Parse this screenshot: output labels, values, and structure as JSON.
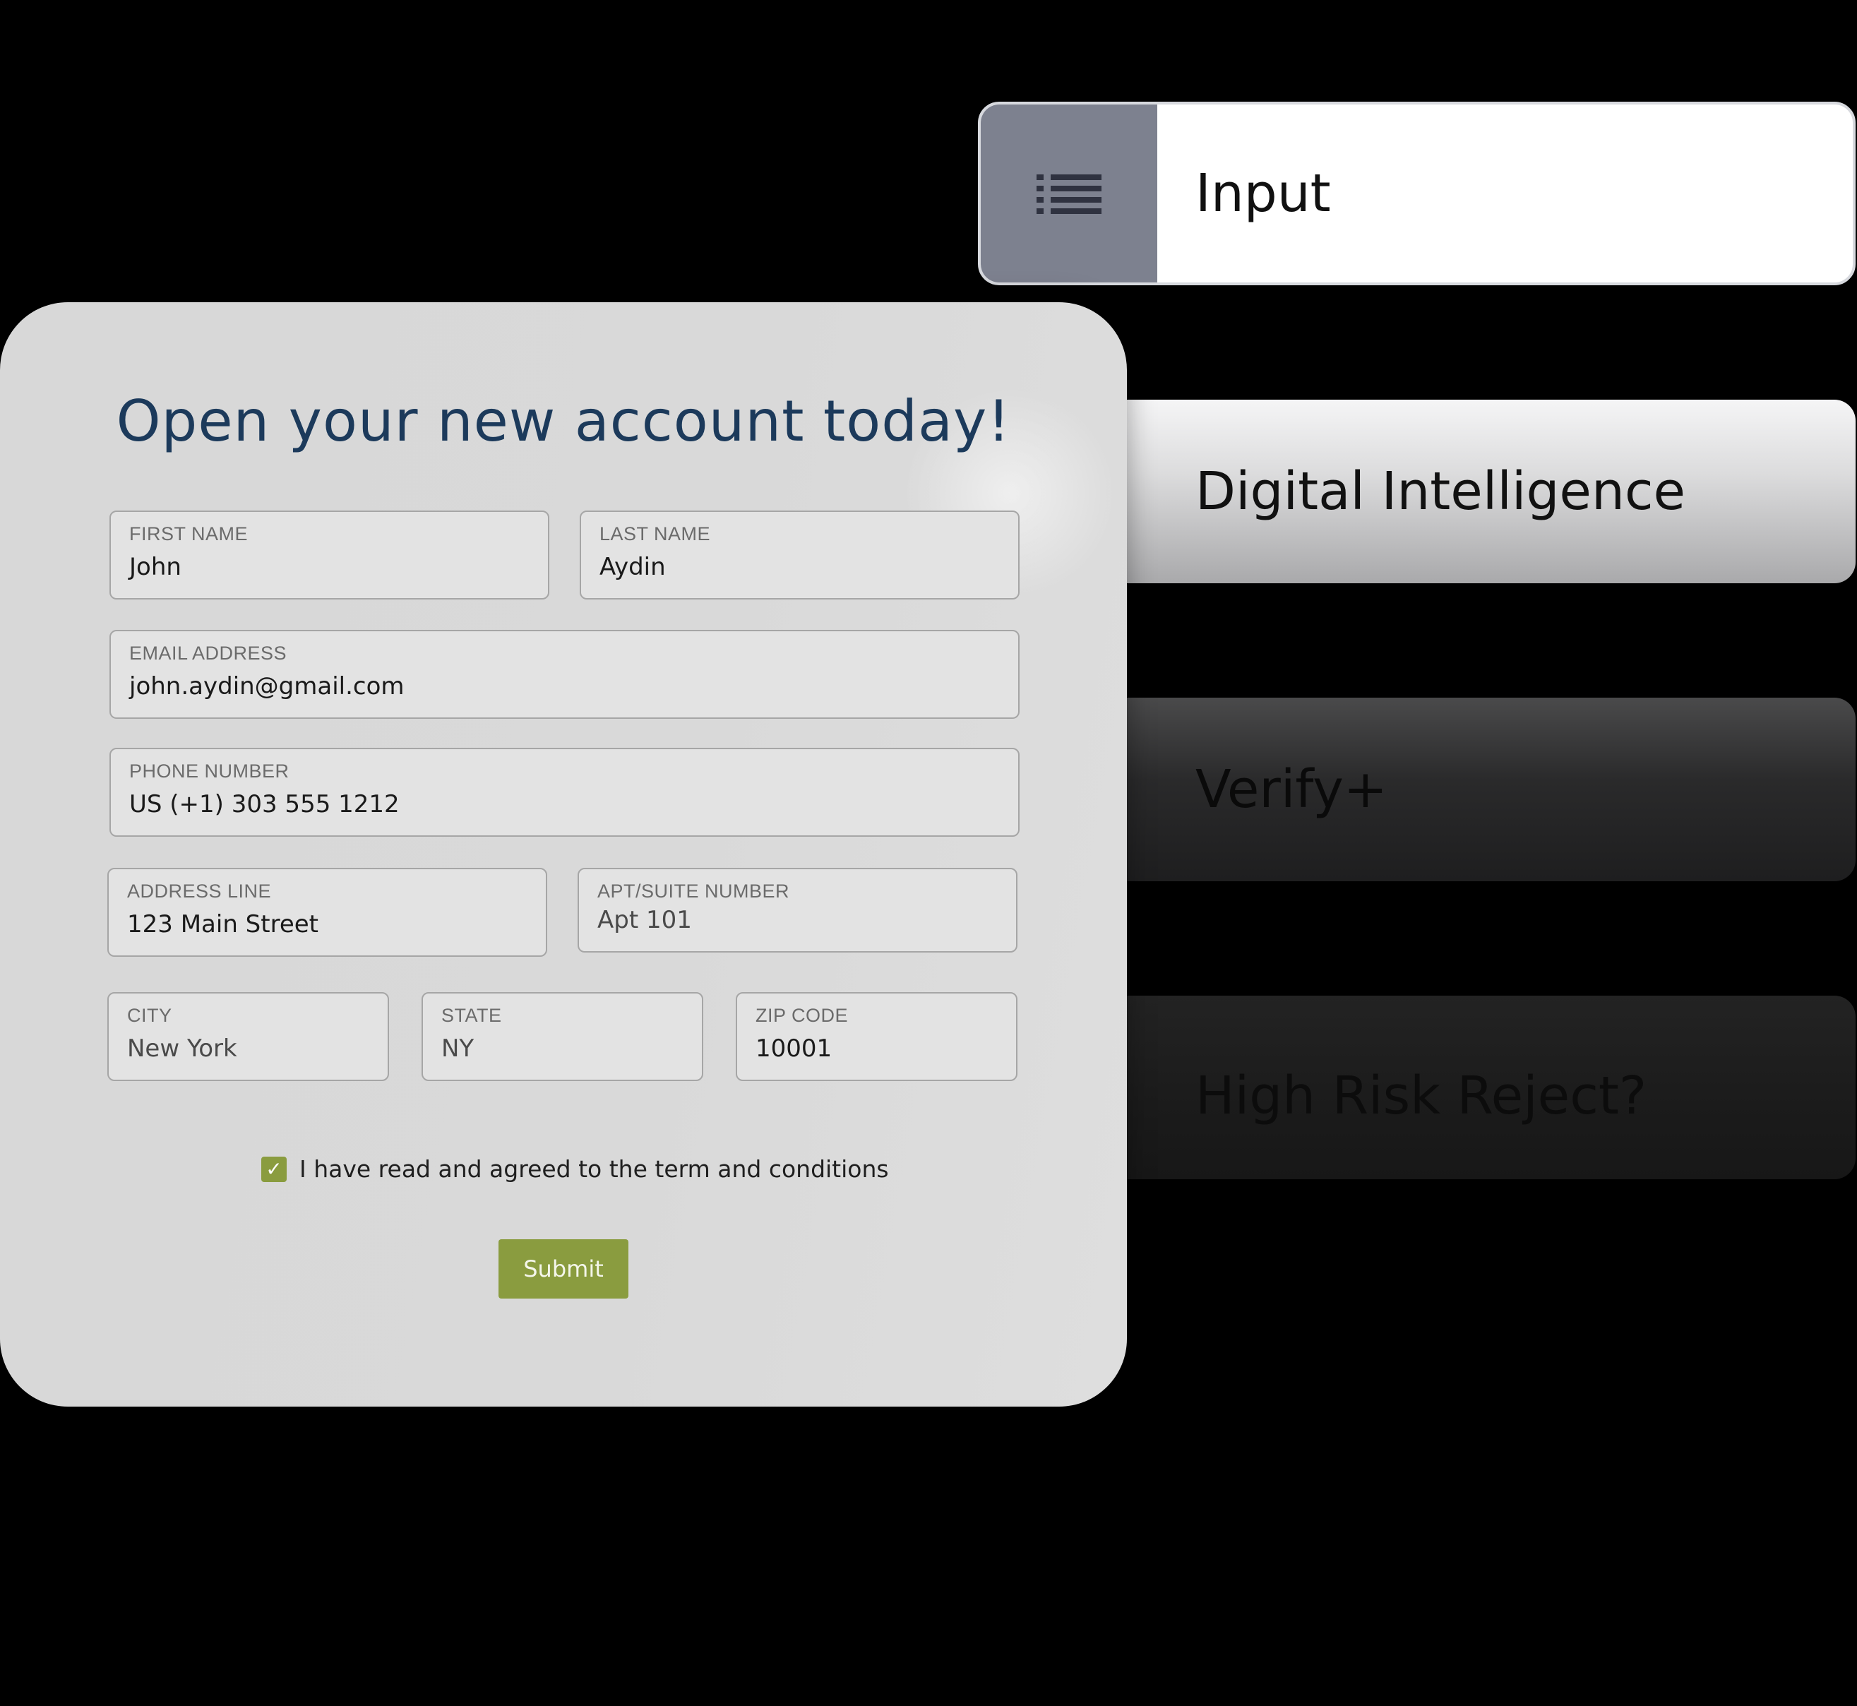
{
  "steps": {
    "input": {
      "label": "Input",
      "icon": "list-icon"
    },
    "digital_intelligence": {
      "label": "Digital Intelligence"
    },
    "verify_plus": {
      "label": "Verify+"
    },
    "high_risk_reject": {
      "label": "High Risk Reject?"
    }
  },
  "form": {
    "title": "Open your new account today!",
    "fields": {
      "first_name": {
        "label": "FIRST NAME",
        "value": "John"
      },
      "last_name": {
        "label": "LAST NAME",
        "value": "Aydin"
      },
      "email": {
        "label": "EMAIL ADDRESS",
        "value": "john.aydin@gmail.com"
      },
      "phone": {
        "label": "PHONE NUMBER",
        "value": "US (+1) 303 555 1212"
      },
      "address_line": {
        "label": "ADDRESS LINE",
        "value": "123 Main Street"
      },
      "apt_suite": {
        "label": "APT/SUITE NUMBER",
        "value": "Apt 101"
      },
      "city": {
        "label": "CITY",
        "value": "New York"
      },
      "state": {
        "label": "STATE",
        "value": "NY"
      },
      "zip": {
        "label": "ZIP CODE",
        "value": "10001"
      }
    },
    "terms": {
      "label": "I have read and agreed to the term and conditions",
      "checked": true
    },
    "submit_label": "Submit"
  },
  "colors": {
    "title": "#1c3a5b",
    "accent_green": "#8a9c3f",
    "icon_cell": "#7d818f",
    "background": "#000000"
  }
}
